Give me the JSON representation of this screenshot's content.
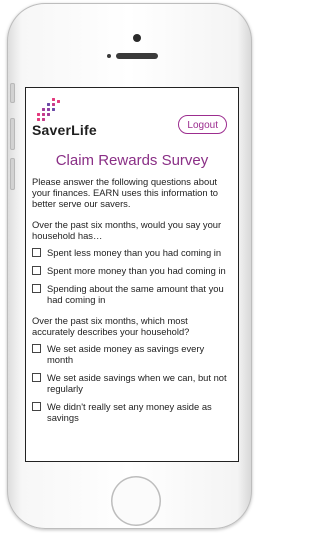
{
  "app": {
    "brand": "SaverLife",
    "logout_label": "Logout",
    "title": "Claim Rewards Survey",
    "intro": "Please answer the following questions about your finances. EARN uses this information to better serve our savers."
  },
  "colors": {
    "accent": "#9c2d8f",
    "logo_dots": [
      "#e33b7e",
      "#a23c9a",
      "#6b4aa7",
      "#c63a8b"
    ]
  },
  "questions": [
    {
      "text": "Over the past six months, would you say your household has…",
      "options": [
        "Spent less money than you had coming in",
        "Spent more money than you had coming in",
        "Spending about the same amount that you had coming in"
      ]
    },
    {
      "text": "Over the past six months, which most accurately describes your household?",
      "options": [
        "We set aside money as savings every month",
        "We set aside savings when we can, but not regularly",
        "We didn't really set any money aside as savings"
      ]
    }
  ]
}
